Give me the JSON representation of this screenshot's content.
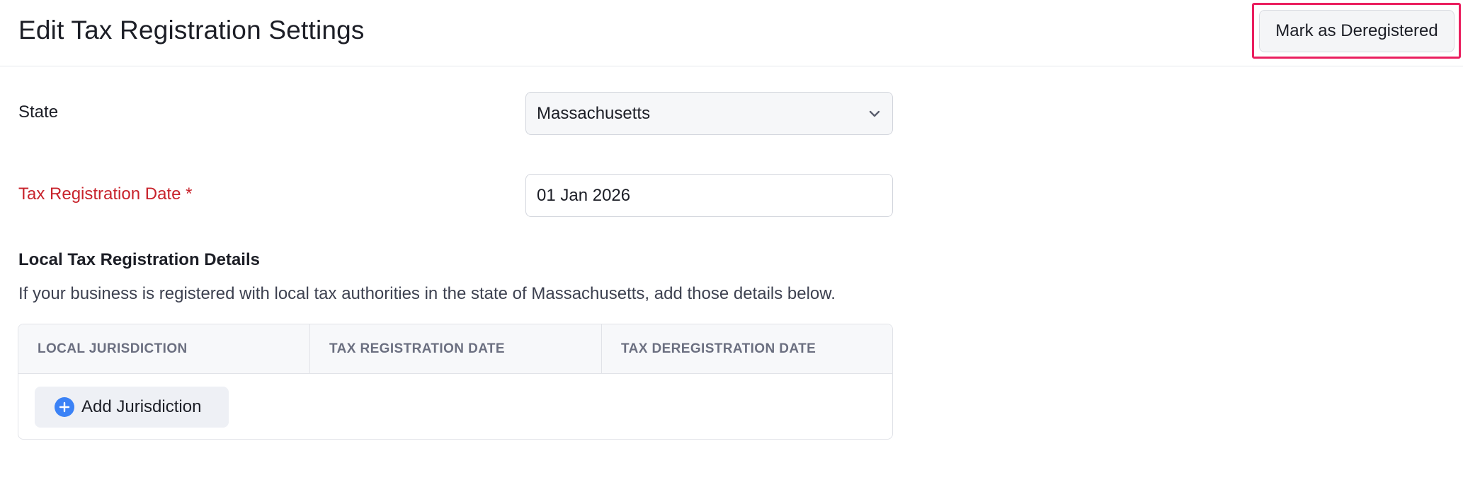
{
  "header": {
    "title": "Edit Tax Registration Settings",
    "deregister_button": "Mark as Deregistered"
  },
  "form": {
    "state": {
      "label": "State",
      "value": "Massachusetts",
      "icon": "chevron-down-icon"
    },
    "registration_date": {
      "label": "Tax Registration Date *",
      "value": "01 Jan 2026"
    }
  },
  "local_section": {
    "title": "Local Tax Registration Details",
    "description": "If your business is registered with local tax authorities in the state of Massachusetts, add those details below.",
    "table": {
      "columns": [
        "LOCAL JURISDICTION",
        "TAX REGISTRATION DATE",
        "TAX DEREGISTRATION DATE"
      ]
    },
    "add_button": "Add Jurisdiction",
    "add_icon": "plus-circle-icon"
  },
  "colors": {
    "accent": "#3b82f6",
    "required_label": "#c8232c",
    "highlight": "#ea1f5f"
  }
}
